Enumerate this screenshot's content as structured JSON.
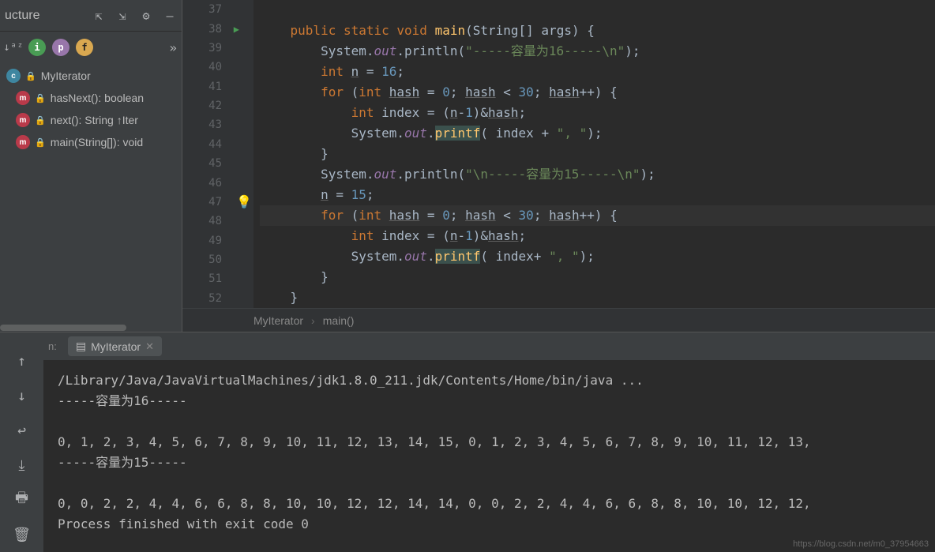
{
  "structure": {
    "title": "ucture",
    "tree": {
      "class_badge": "c",
      "class_name": "MyIterator",
      "methods": [
        {
          "badge": "m",
          "label": "hasNext(): boolean"
        },
        {
          "badge": "m",
          "label": "next(): String ↑Iter"
        },
        {
          "badge": "m",
          "label": "main(String[]): void"
        }
      ]
    },
    "filter_badges": {
      "i": "i",
      "p": "p",
      "f": "f"
    },
    "more": "»"
  },
  "editor": {
    "line_start": 37,
    "lines": [
      {
        "n": "37",
        "tokens": []
      },
      {
        "n": "38",
        "run": true,
        "tokens": [
          {
            "t": "    ",
            "c": "def"
          },
          {
            "t": "public static void ",
            "c": "kw"
          },
          {
            "t": "main",
            "c": "me"
          },
          {
            "t": "(String[] args) {",
            "c": "def"
          }
        ]
      },
      {
        "n": "39",
        "tokens": [
          {
            "t": "        System.",
            "c": "def"
          },
          {
            "t": "out",
            "c": "it"
          },
          {
            "t": ".println(",
            "c": "def"
          },
          {
            "t": "\"-----容量为16-----\\n\"",
            "c": "str"
          },
          {
            "t": ");",
            "c": "def"
          }
        ]
      },
      {
        "n": "40",
        "tokens": [
          {
            "t": "        ",
            "c": "def"
          },
          {
            "t": "int ",
            "c": "kw"
          },
          {
            "t": "n",
            "c": "var-u"
          },
          {
            "t": " = ",
            "c": "def"
          },
          {
            "t": "16",
            "c": "num"
          },
          {
            "t": ";",
            "c": "def"
          }
        ]
      },
      {
        "n": "41",
        "tokens": [
          {
            "t": "        ",
            "c": "def"
          },
          {
            "t": "for ",
            "c": "kw"
          },
          {
            "t": "(",
            "c": "def"
          },
          {
            "t": "int ",
            "c": "kw"
          },
          {
            "t": "hash",
            "c": "var-u"
          },
          {
            "t": " = ",
            "c": "def"
          },
          {
            "t": "0",
            "c": "num"
          },
          {
            "t": "; ",
            "c": "def"
          },
          {
            "t": "hash",
            "c": "var-u"
          },
          {
            "t": " < ",
            "c": "def"
          },
          {
            "t": "30",
            "c": "num"
          },
          {
            "t": "; ",
            "c": "def"
          },
          {
            "t": "hash",
            "c": "var-u"
          },
          {
            "t": "++) {",
            "c": "def"
          }
        ]
      },
      {
        "n": "42",
        "tokens": [
          {
            "t": "            ",
            "c": "def"
          },
          {
            "t": "int ",
            "c": "kw"
          },
          {
            "t": "index = (",
            "c": "def"
          },
          {
            "t": "n",
            "c": "var-u"
          },
          {
            "t": "-",
            "c": "def"
          },
          {
            "t": "1",
            "c": "num"
          },
          {
            "t": ")&",
            "c": "def"
          },
          {
            "t": "hash",
            "c": "var-u"
          },
          {
            "t": ";",
            "c": "def"
          }
        ]
      },
      {
        "n": "43",
        "tokens": [
          {
            "t": "            System.",
            "c": "def"
          },
          {
            "t": "out",
            "c": "it"
          },
          {
            "t": ".",
            "c": "def"
          },
          {
            "t": "printf",
            "c": "me-hl"
          },
          {
            "t": "( index + ",
            "c": "def"
          },
          {
            "t": "\", \"",
            "c": "str"
          },
          {
            "t": ");",
            "c": "def"
          }
        ]
      },
      {
        "n": "44",
        "tokens": [
          {
            "t": "        }",
            "c": "def"
          }
        ]
      },
      {
        "n": "45",
        "tokens": [
          {
            "t": "        System.",
            "c": "def"
          },
          {
            "t": "out",
            "c": "it"
          },
          {
            "t": ".println(",
            "c": "def"
          },
          {
            "t": "\"\\n-----容量为15-----\\n\"",
            "c": "str"
          },
          {
            "t": ");",
            "c": "def"
          }
        ]
      },
      {
        "n": "46",
        "tokens": [
          {
            "t": "        ",
            "c": "def"
          },
          {
            "t": "n",
            "c": "var-u"
          },
          {
            "t": " = ",
            "c": "def"
          },
          {
            "t": "15",
            "c": "num"
          },
          {
            "t": ";",
            "c": "def"
          }
        ]
      },
      {
        "n": "47",
        "hl": true,
        "bulb": true,
        "tokens": [
          {
            "t": "        ",
            "c": "def"
          },
          {
            "t": "for ",
            "c": "kw"
          },
          {
            "t": "(",
            "c": "def"
          },
          {
            "t": "int ",
            "c": "kw"
          },
          {
            "t": "hash",
            "c": "var-u"
          },
          {
            "t": " = ",
            "c": "def"
          },
          {
            "t": "0",
            "c": "num"
          },
          {
            "t": "; ",
            "c": "def"
          },
          {
            "t": "hash",
            "c": "var-u"
          },
          {
            "t": " < ",
            "c": "def"
          },
          {
            "t": "30",
            "c": "num"
          },
          {
            "t": "; ",
            "c": "def"
          },
          {
            "t": "hash",
            "c": "var-u"
          },
          {
            "t": "++) {",
            "c": "def"
          }
        ]
      },
      {
        "n": "48",
        "tokens": [
          {
            "t": "            ",
            "c": "def"
          },
          {
            "t": "int ",
            "c": "kw"
          },
          {
            "t": "index = (",
            "c": "def"
          },
          {
            "t": "n",
            "c": "var-u"
          },
          {
            "t": "-",
            "c": "def"
          },
          {
            "t": "1",
            "c": "num"
          },
          {
            "t": ")&",
            "c": "def"
          },
          {
            "t": "hash",
            "c": "var-u"
          },
          {
            "t": ";",
            "c": "def"
          }
        ]
      },
      {
        "n": "49",
        "tokens": [
          {
            "t": "            System.",
            "c": "def"
          },
          {
            "t": "out",
            "c": "it"
          },
          {
            "t": ".",
            "c": "def"
          },
          {
            "t": "printf",
            "c": "me-hl"
          },
          {
            "t": "( index+ ",
            "c": "def"
          },
          {
            "t": "\", \"",
            "c": "str"
          },
          {
            "t": ");",
            "c": "def"
          }
        ]
      },
      {
        "n": "50",
        "tokens": [
          {
            "t": "        }",
            "c": "def"
          }
        ]
      },
      {
        "n": "51",
        "tokens": [
          {
            "t": "    }",
            "c": "def"
          }
        ]
      },
      {
        "n": "52",
        "tokens": [
          {
            "t": "}",
            "c": "def"
          }
        ]
      }
    ],
    "breadcrumb": {
      "class": "MyIterator",
      "method": "main()",
      "sep": "›"
    }
  },
  "run": {
    "label": "n:",
    "tab": "MyIterator",
    "console_lines": [
      "/Library/Java/JavaVirtualMachines/jdk1.8.0_211.jdk/Contents/Home/bin/java ...",
      "-----容量为16-----",
      "",
      "0, 1, 2, 3, 4, 5, 6, 7, 8, 9, 10, 11, 12, 13, 14, 15, 0, 1, 2, 3, 4, 5, 6, 7, 8, 9, 10, 11, 12, 13,",
      "-----容量为15-----",
      "",
      "0, 0, 2, 2, 4, 4, 6, 6, 8, 8, 10, 10, 12, 12, 14, 14, 0, 0, 2, 2, 4, 4, 6, 6, 8, 8, 10, 10, 12, 12,",
      "Process finished with exit code 0"
    ]
  },
  "watermark": "https://blog.csdn.net/m0_37954663"
}
